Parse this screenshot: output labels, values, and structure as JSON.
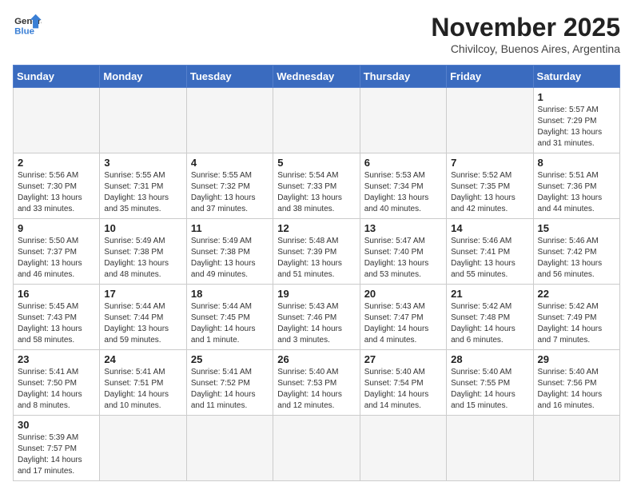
{
  "header": {
    "logo_general": "General",
    "logo_blue": "Blue",
    "month_title": "November 2025",
    "location": "Chivilcoy, Buenos Aires, Argentina"
  },
  "days_of_week": [
    "Sunday",
    "Monday",
    "Tuesday",
    "Wednesday",
    "Thursday",
    "Friday",
    "Saturday"
  ],
  "weeks": [
    [
      {
        "day": "",
        "info": ""
      },
      {
        "day": "",
        "info": ""
      },
      {
        "day": "",
        "info": ""
      },
      {
        "day": "",
        "info": ""
      },
      {
        "day": "",
        "info": ""
      },
      {
        "day": "",
        "info": ""
      },
      {
        "day": "1",
        "info": "Sunrise: 5:57 AM\nSunset: 7:29 PM\nDaylight: 13 hours and 31 minutes."
      }
    ],
    [
      {
        "day": "2",
        "info": "Sunrise: 5:56 AM\nSunset: 7:30 PM\nDaylight: 13 hours and 33 minutes."
      },
      {
        "day": "3",
        "info": "Sunrise: 5:55 AM\nSunset: 7:31 PM\nDaylight: 13 hours and 35 minutes."
      },
      {
        "day": "4",
        "info": "Sunrise: 5:55 AM\nSunset: 7:32 PM\nDaylight: 13 hours and 37 minutes."
      },
      {
        "day": "5",
        "info": "Sunrise: 5:54 AM\nSunset: 7:33 PM\nDaylight: 13 hours and 38 minutes."
      },
      {
        "day": "6",
        "info": "Sunrise: 5:53 AM\nSunset: 7:34 PM\nDaylight: 13 hours and 40 minutes."
      },
      {
        "day": "7",
        "info": "Sunrise: 5:52 AM\nSunset: 7:35 PM\nDaylight: 13 hours and 42 minutes."
      },
      {
        "day": "8",
        "info": "Sunrise: 5:51 AM\nSunset: 7:36 PM\nDaylight: 13 hours and 44 minutes."
      }
    ],
    [
      {
        "day": "9",
        "info": "Sunrise: 5:50 AM\nSunset: 7:37 PM\nDaylight: 13 hours and 46 minutes."
      },
      {
        "day": "10",
        "info": "Sunrise: 5:49 AM\nSunset: 7:38 PM\nDaylight: 13 hours and 48 minutes."
      },
      {
        "day": "11",
        "info": "Sunrise: 5:49 AM\nSunset: 7:38 PM\nDaylight: 13 hours and 49 minutes."
      },
      {
        "day": "12",
        "info": "Sunrise: 5:48 AM\nSunset: 7:39 PM\nDaylight: 13 hours and 51 minutes."
      },
      {
        "day": "13",
        "info": "Sunrise: 5:47 AM\nSunset: 7:40 PM\nDaylight: 13 hours and 53 minutes."
      },
      {
        "day": "14",
        "info": "Sunrise: 5:46 AM\nSunset: 7:41 PM\nDaylight: 13 hours and 55 minutes."
      },
      {
        "day": "15",
        "info": "Sunrise: 5:46 AM\nSunset: 7:42 PM\nDaylight: 13 hours and 56 minutes."
      }
    ],
    [
      {
        "day": "16",
        "info": "Sunrise: 5:45 AM\nSunset: 7:43 PM\nDaylight: 13 hours and 58 minutes."
      },
      {
        "day": "17",
        "info": "Sunrise: 5:44 AM\nSunset: 7:44 PM\nDaylight: 13 hours and 59 minutes."
      },
      {
        "day": "18",
        "info": "Sunrise: 5:44 AM\nSunset: 7:45 PM\nDaylight: 14 hours and 1 minute."
      },
      {
        "day": "19",
        "info": "Sunrise: 5:43 AM\nSunset: 7:46 PM\nDaylight: 14 hours and 3 minutes."
      },
      {
        "day": "20",
        "info": "Sunrise: 5:43 AM\nSunset: 7:47 PM\nDaylight: 14 hours and 4 minutes."
      },
      {
        "day": "21",
        "info": "Sunrise: 5:42 AM\nSunset: 7:48 PM\nDaylight: 14 hours and 6 minutes."
      },
      {
        "day": "22",
        "info": "Sunrise: 5:42 AM\nSunset: 7:49 PM\nDaylight: 14 hours and 7 minutes."
      }
    ],
    [
      {
        "day": "23",
        "info": "Sunrise: 5:41 AM\nSunset: 7:50 PM\nDaylight: 14 hours and 8 minutes."
      },
      {
        "day": "24",
        "info": "Sunrise: 5:41 AM\nSunset: 7:51 PM\nDaylight: 14 hours and 10 minutes."
      },
      {
        "day": "25",
        "info": "Sunrise: 5:41 AM\nSunset: 7:52 PM\nDaylight: 14 hours and 11 minutes."
      },
      {
        "day": "26",
        "info": "Sunrise: 5:40 AM\nSunset: 7:53 PM\nDaylight: 14 hours and 12 minutes."
      },
      {
        "day": "27",
        "info": "Sunrise: 5:40 AM\nSunset: 7:54 PM\nDaylight: 14 hours and 14 minutes."
      },
      {
        "day": "28",
        "info": "Sunrise: 5:40 AM\nSunset: 7:55 PM\nDaylight: 14 hours and 15 minutes."
      },
      {
        "day": "29",
        "info": "Sunrise: 5:40 AM\nSunset: 7:56 PM\nDaylight: 14 hours and 16 minutes."
      }
    ],
    [
      {
        "day": "30",
        "info": "Sunrise: 5:39 AM\nSunset: 7:57 PM\nDaylight: 14 hours and 17 minutes."
      },
      {
        "day": "",
        "info": ""
      },
      {
        "day": "",
        "info": ""
      },
      {
        "day": "",
        "info": ""
      },
      {
        "day": "",
        "info": ""
      },
      {
        "day": "",
        "info": ""
      },
      {
        "day": "",
        "info": ""
      }
    ]
  ]
}
